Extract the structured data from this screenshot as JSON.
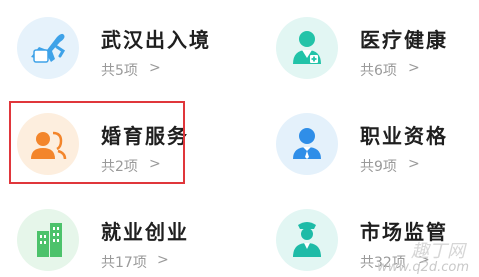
{
  "services": [
    {
      "title": "武汉出入境",
      "count": "共5项",
      "arrow": ">",
      "icon": "plane-passport-icon",
      "icon_bg": "#e6f2fb",
      "icon_color": "#3ea2e8"
    },
    {
      "title": "医疗健康",
      "count": "共6项",
      "arrow": ">",
      "icon": "doctor-icon",
      "icon_bg": "#e2f6f3",
      "icon_color": "#22c3a8"
    },
    {
      "title": "婚育服务",
      "count": "共2项",
      "arrow": ">",
      "icon": "couple-icon",
      "icon_bg": "#fdeede",
      "icon_color": "#f3852b"
    },
    {
      "title": "职业资格",
      "count": "共9项",
      "arrow": ">",
      "icon": "professional-person-icon",
      "icon_bg": "#e4f1fb",
      "icon_color": "#2f8ee8"
    },
    {
      "title": "就业创业",
      "count": "共17项",
      "arrow": ">",
      "icon": "buildings-icon",
      "icon_bg": "#e6f6ea",
      "icon_color": "#4cc26b"
    },
    {
      "title": "市场监管",
      "count": "共32项",
      "arrow": ">",
      "icon": "officer-icon",
      "icon_bg": "#e2f6f3",
      "icon_color": "#1ebba7"
    }
  ],
  "highlight_color": "#e0363b",
  "watermark": {
    "top": "趣丁网",
    "bottom": "www.q2d.com"
  }
}
